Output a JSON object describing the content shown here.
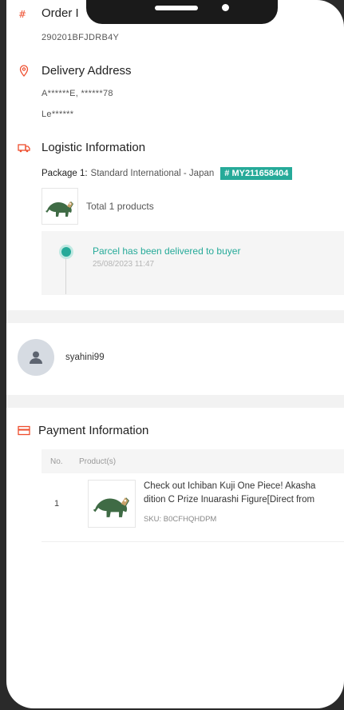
{
  "order": {
    "title": "Order I",
    "id": "290201BFJDRB4Y"
  },
  "delivery": {
    "title": "Delivery Address",
    "line1": "A******E, ******78",
    "line2": "Le******"
  },
  "logistics": {
    "title": "Logistic Information",
    "package_label": "Package 1:",
    "service": "Standard International - Japan",
    "tracking": "# MY211658404",
    "total_products": "Total 1 products",
    "status": "Parcel has been delivered to buyer",
    "status_time": "25/08/2023 11:47"
  },
  "buyer": {
    "username": "syahini99"
  },
  "payment": {
    "title": "Payment Information",
    "columns": [
      "No.",
      "Product(s)"
    ],
    "rows": [
      {
        "no": "1",
        "name_line1": "Check out Ichiban Kuji One Piece! Akasha",
        "name_line2": "dition C Prize Inuarashi Figure[Direct from",
        "sku": "SKU: B0CFHQHDPM"
      }
    ]
  },
  "colors": {
    "accent": "#ee4d2d",
    "teal": "#26aa99"
  }
}
